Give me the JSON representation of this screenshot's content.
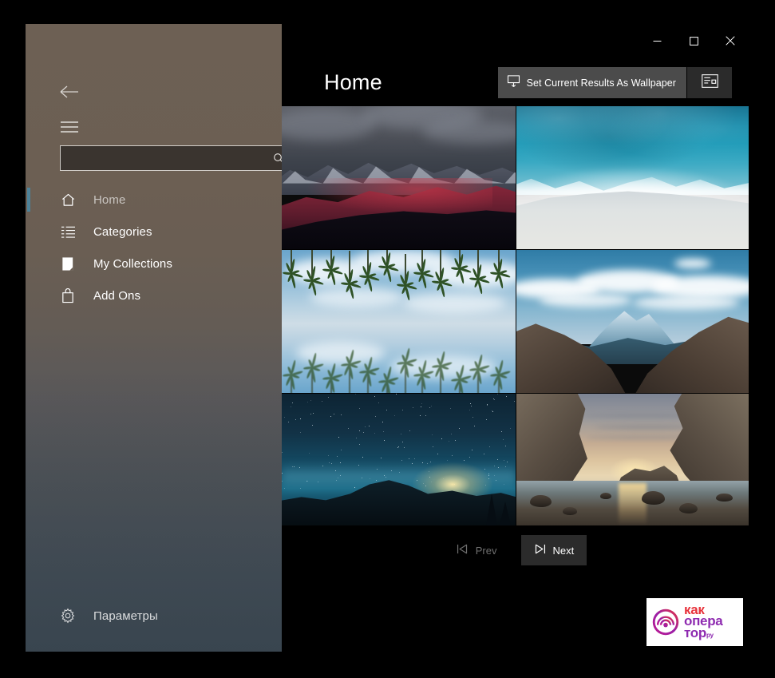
{
  "window": {
    "caption_buttons": [
      {
        "name": "minimize",
        "glyph": "minimize-icon"
      },
      {
        "name": "maximize",
        "glyph": "maximize-icon"
      },
      {
        "name": "close",
        "glyph": "close-icon"
      }
    ]
  },
  "sidebar": {
    "back_icon": "back-arrow-icon",
    "menu_icon": "hamburger-menu-icon",
    "search": {
      "value": "",
      "placeholder": "",
      "icon": "search-icon"
    },
    "items": [
      {
        "label": "Home",
        "icon": "home-icon",
        "selected": true
      },
      {
        "label": "Categories",
        "icon": "list-icon",
        "selected": false
      },
      {
        "label": "My Collections",
        "icon": "collection-icon",
        "selected": false
      },
      {
        "label": "Add Ons",
        "icon": "bag-icon",
        "selected": false
      }
    ],
    "settings": {
      "label": "Параметры",
      "icon": "gear-icon"
    },
    "accent_color": "#4d8299"
  },
  "header": {
    "title": "Home",
    "set_wallpaper_button": {
      "label": "Set Current Results As Wallpaper",
      "icon": "monitor-upload-icon"
    },
    "view_toggle_button": {
      "icon": "details-view-icon"
    }
  },
  "grid": {
    "thumbnails": [
      {
        "alt": "Dark mountain range with red alpenglow under storm clouds"
      },
      {
        "alt": "Aerial view of turquoise ocean surf meeting pale sand beach"
      },
      {
        "alt": "Palm trees mirrored in still water under blue cloudy sky"
      },
      {
        "alt": "Brown mountain valley with snow-capped peak and blue sky"
      },
      {
        "alt": "Starry night sky over Half Dome with moonrise glow"
      },
      {
        "alt": "Rocky sea stacks and coastal cove at golden hour sunset"
      }
    ]
  },
  "pager": {
    "prev": {
      "label": "Prev",
      "icon": "skip-back-icon",
      "enabled": false
    },
    "next": {
      "label": "Next",
      "icon": "skip-forward-icon",
      "enabled": true
    }
  },
  "watermark": {
    "line1": "как",
    "line2": "опера",
    "line3": "тор",
    "suffix": "ру",
    "mark": "signal-wave-logo",
    "color_red": "#e8333c",
    "color_purple": "#8e2bb0"
  }
}
